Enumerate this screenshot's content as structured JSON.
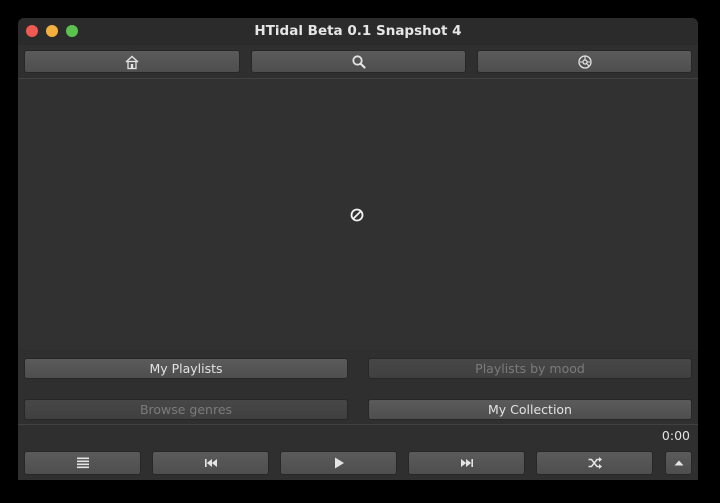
{
  "window": {
    "title": "HTidal Beta 0.1 Snapshot 4"
  },
  "toolbar": {
    "home_icon": "home-icon",
    "search_icon": "search-icon",
    "settings_icon": "dashboard-icon"
  },
  "content": {
    "status_icon": "no-entry-icon"
  },
  "categories": {
    "my_playlists": "My Playlists",
    "playlists_by_mood": "Playlists by mood",
    "browse_genres": "Browse genres",
    "my_collection": "My Collection"
  },
  "player": {
    "time": "0:00",
    "queue_icon": "list-icon",
    "previous_icon": "skip-previous-icon",
    "play_icon": "play-icon",
    "next_icon": "skip-next-icon",
    "shuffle_icon": "shuffle-icon",
    "expand_icon": "chevron-up-icon"
  },
  "colors": {
    "window_bg": "#2f2f2f",
    "button_bg": "#555555",
    "button_disabled_bg": "#444444",
    "text": "#e2e2e2",
    "text_disabled": "#7b7b7b",
    "close": "#ee5a52",
    "minimize": "#f4b03c",
    "maximize": "#5bc34d"
  }
}
